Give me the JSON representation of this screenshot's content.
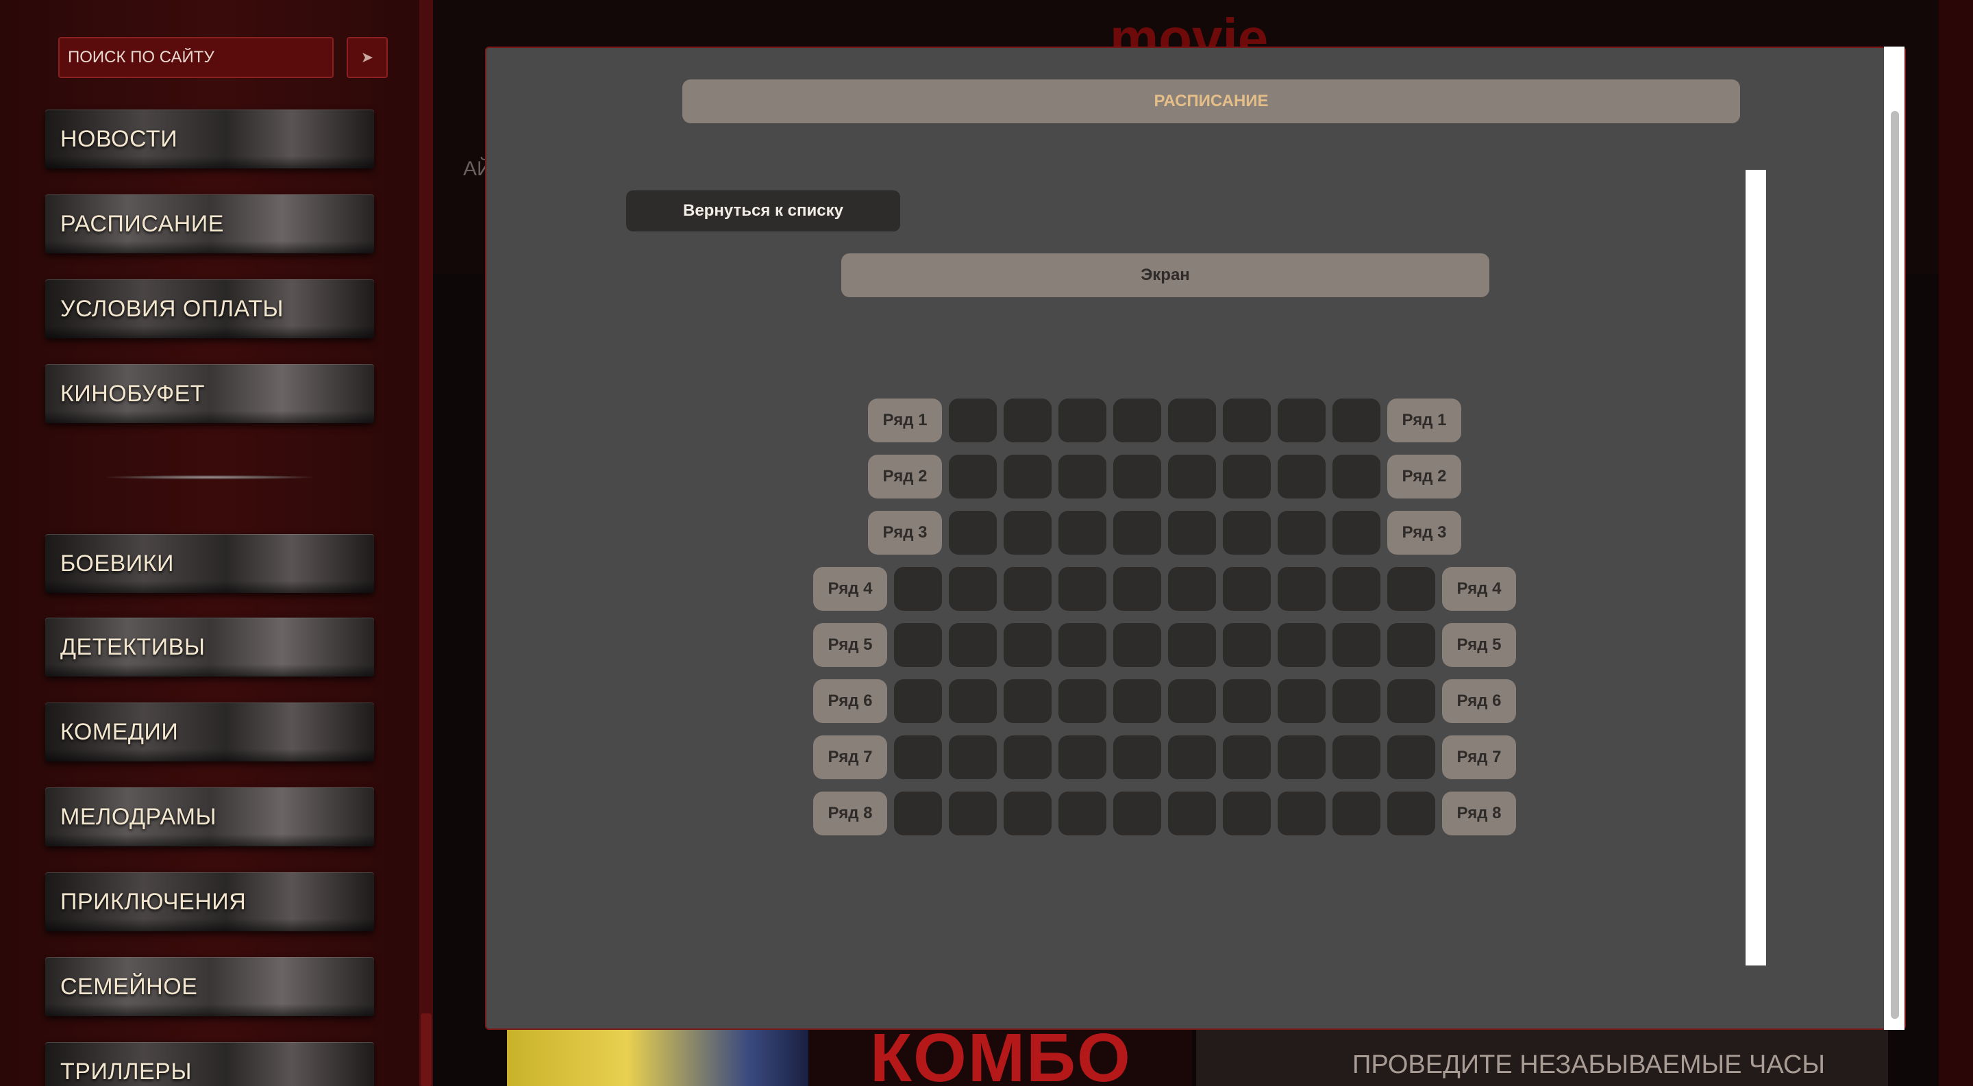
{
  "sidebar": {
    "search": {
      "placeholder": "ПОИСК ПО САЙТУ",
      "submit_glyph": "➤"
    },
    "menu_primary": [
      "НОВОСТИ",
      "РАСПИСАНИЕ",
      "УСЛОВИЯ ОПЛАТЫ",
      "КИНОБУФЕТ"
    ],
    "menu_genres": [
      "БОЕВИКИ",
      "ДЕТЕКТИВЫ",
      "КОМЕДИИ",
      "МЕЛОДРАМЫ",
      "ПРИКЛЮЧЕНИЯ",
      "СЕМЕЙНОЕ",
      "ТРИЛЛЕРЫ"
    ]
  },
  "background": {
    "logo_fragment": "movie",
    "text_fragment": "АЙ",
    "banner_combo": "КОМБО",
    "banner_slogan": "ПРОВЕДИТЕ НЕЗАБЫВАЕМЫЕ ЧАСЫ"
  },
  "modal": {
    "title": "РАСПИСАНИЕ",
    "back_button": "Вернуться к списку",
    "screen_label": "Экран",
    "rows": [
      {
        "label": "Ряд 1",
        "seats": 8
      },
      {
        "label": "Ряд 2",
        "seats": 8
      },
      {
        "label": "Ряд 3",
        "seats": 8
      },
      {
        "label": "Ряд 4",
        "seats": 10
      },
      {
        "label": "Ряд 5",
        "seats": 10
      },
      {
        "label": "Ряд 6",
        "seats": 10
      },
      {
        "label": "Ряд 7",
        "seats": 10
      },
      {
        "label": "Ряд 8",
        "seats": 10
      }
    ]
  },
  "colors": {
    "accent_title": "#e4be88",
    "seat_free": "#2e2c2a",
    "row_label_bg": "#898079",
    "modal_bg": "#4a4a4a"
  }
}
